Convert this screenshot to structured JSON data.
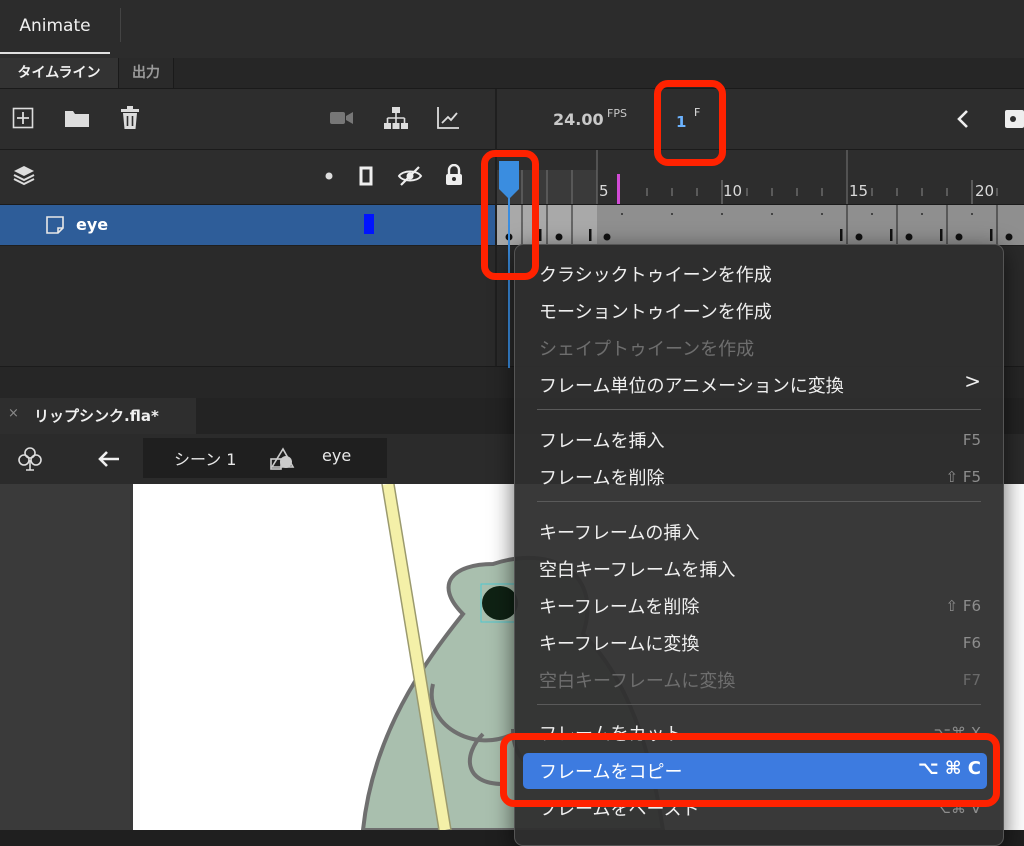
{
  "app": {
    "tab_label": "Animate"
  },
  "panel_tabs": {
    "timeline": "タイムライン",
    "output": "出力"
  },
  "toolbar": {
    "fps_value": "24.00",
    "fps_unit": "FPS",
    "current_frame": "1",
    "frame_unit": "F"
  },
  "ruler": {
    "labels": [
      "5",
      "10",
      "15",
      "20"
    ]
  },
  "layer": {
    "name": "eye",
    "color": "#0014ff"
  },
  "document": {
    "title": "リップシンク.fla*",
    "close": "×"
  },
  "editbar": {
    "scene": "シーン 1",
    "symbol": "eye"
  },
  "context_menu": {
    "items": [
      {
        "label": "クラシックトゥイーンを作成",
        "shortcut": "",
        "enabled": true
      },
      {
        "label": "モーショントゥイーンを作成",
        "shortcut": "",
        "enabled": true
      },
      {
        "label": "シェイプトゥイーンを作成",
        "shortcut": "",
        "enabled": false
      },
      {
        "label": "フレーム単位のアニメーションに変換",
        "shortcut": ">",
        "enabled": true
      },
      {
        "label": "フレームを挿入",
        "shortcut": "F5",
        "enabled": true
      },
      {
        "label": "フレームを削除",
        "shortcut": "⇧ F5",
        "enabled": true
      },
      {
        "label": "キーフレームの挿入",
        "shortcut": "",
        "enabled": true
      },
      {
        "label": "空白キーフレームを挿入",
        "shortcut": "",
        "enabled": true
      },
      {
        "label": "キーフレームを削除",
        "shortcut": "⇧ F6",
        "enabled": true
      },
      {
        "label": "キーフレームに変換",
        "shortcut": "F6",
        "enabled": true
      },
      {
        "label": "空白キーフレームに変換",
        "shortcut": "F7",
        "enabled": false
      },
      {
        "label": "フレームをカット",
        "shortcut": "⌥⌘ X",
        "enabled": true
      },
      {
        "label": "フレームをコピー",
        "shortcut": "⌥ ⌘ C",
        "enabled": true,
        "highlighted": true
      },
      {
        "label": "フレームをペースト",
        "shortcut": "⌥⌘ V",
        "enabled": true
      }
    ]
  },
  "colors": {
    "accent": "#3d7be0",
    "layer_selected": "#2e5d99",
    "annotation": "#ff2200",
    "playhead": "#3a8de0"
  }
}
